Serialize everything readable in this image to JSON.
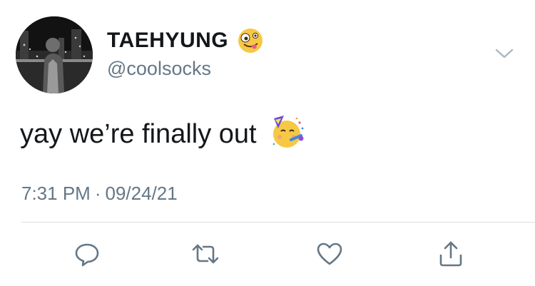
{
  "user": {
    "display_name": "TAEHYUNG",
    "handle": "@coolsocks",
    "avatar_icon": "profile-photo",
    "name_emoji_icon": "zany-face-emoji"
  },
  "tweet": {
    "text": "yay we’re finally out",
    "text_emoji_icon": "partying-face-emoji"
  },
  "meta": {
    "time": "7:31 PM",
    "separator": "·",
    "date": "09/24/21"
  },
  "actions": {
    "reply_icon": "reply-icon",
    "retweet_icon": "retweet-icon",
    "like_icon": "heart-icon",
    "share_icon": "share-icon"
  },
  "colors": {
    "text": "#14171a",
    "secondary": "#657786",
    "divider": "#d9dee2"
  }
}
